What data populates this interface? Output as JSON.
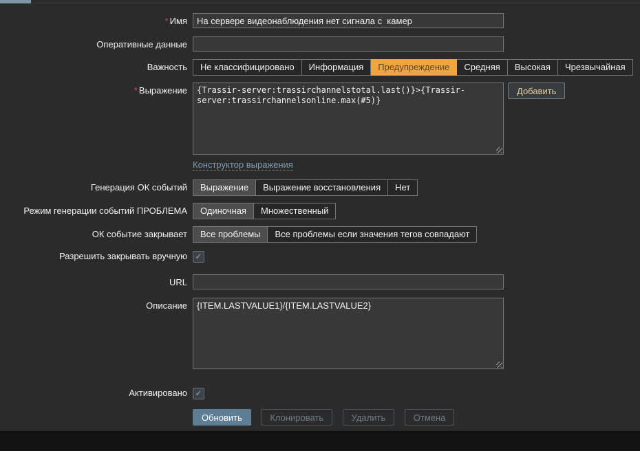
{
  "icons": {
    "checkmark": "✓"
  },
  "theme": {
    "warning_selected_color": "#f0a53f",
    "primary_button_color": "#5e7e96",
    "link_color": "#7e9cb0",
    "tab_indicator_color": "#7e95a4"
  },
  "form": {
    "required_marker": "*",
    "name": {
      "label": "Имя",
      "value": "На сервере видеонаблюдения нет сигнала с  камер"
    },
    "operational_data": {
      "label": "Оперативные данные",
      "value": ""
    },
    "severity": {
      "label": "Важность",
      "options": [
        "Не классифицировано",
        "Информация",
        "Предупреждение",
        "Средняя",
        "Высокая",
        "Чрезвычайная"
      ],
      "selected": "Предупреждение"
    },
    "expression": {
      "label": "Выражение",
      "value": "{Trassir-server:trassirchannelstotal.last()}>{Trassir-server:trassirchannelsonline.max(#5)}",
      "add_button": "Добавить",
      "constructor_link": "Конструктор выражения"
    },
    "ok_event_generation": {
      "label": "Генерация ОК событий",
      "options": [
        "Выражение",
        "Выражение восстановления",
        "Нет"
      ],
      "selected": "Выражение"
    },
    "problem_event_mode": {
      "label": "Режим генерации событий ПРОБЛЕМА",
      "options": [
        "Одиночная",
        "Множественный"
      ],
      "selected": "Одиночная"
    },
    "ok_event_closes": {
      "label": "ОК событие закрывает",
      "options": [
        "Все проблемы",
        "Все проблемы если значения тегов совпадают"
      ],
      "selected": "Все проблемы"
    },
    "manual_close": {
      "label": "Разрешить закрывать вручную",
      "checked": true
    },
    "url": {
      "label": "URL",
      "value": ""
    },
    "description": {
      "label": "Описание",
      "value": "{ITEM.LASTVALUE1}/{ITEM.LASTVALUE2}"
    },
    "enabled": {
      "label": "Активировано",
      "checked": true
    },
    "actions": {
      "update": "Обновить",
      "clone": "Клонировать",
      "delete": "Удалить",
      "cancel": "Отмена"
    }
  }
}
